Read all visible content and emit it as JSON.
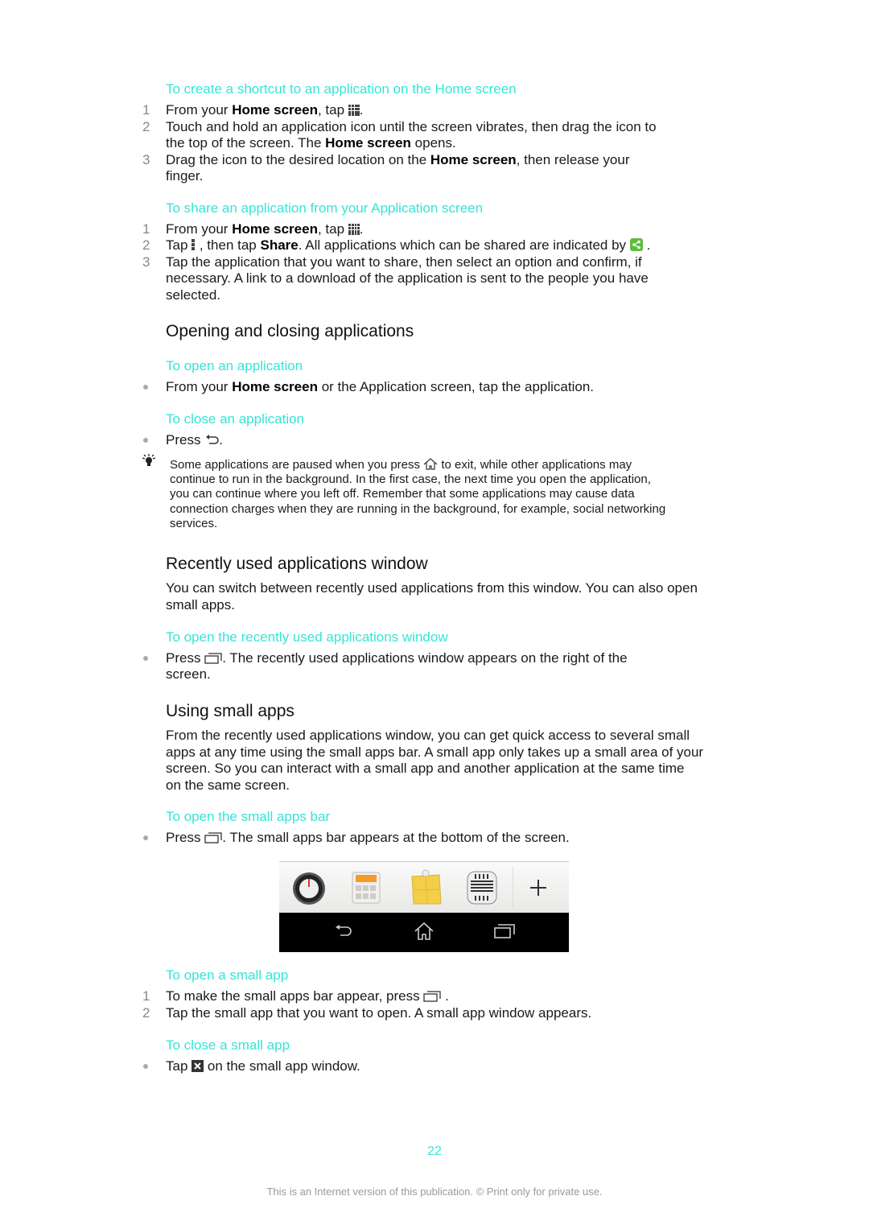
{
  "sections": {
    "shortcut": {
      "heading": "To create a shortcut to an application on the Home screen",
      "steps": [
        {
          "num": "1",
          "pre": "From your ",
          "bold": "Home screen",
          "post": ", tap ",
          "end": "."
        },
        {
          "num": "2",
          "line1": "Touch and hold an application icon until the screen vibrates, then drag the icon to",
          "line2_pre": "the top of the screen. The ",
          "bold": "Home screen",
          "line2_post": " opens."
        },
        {
          "num": "3",
          "pre": "Drag the icon to the desired location on the ",
          "bold": "Home screen",
          "post": ", then release your",
          "line2": "finger."
        }
      ]
    },
    "share": {
      "heading": "To share an application from your Application screen",
      "steps": [
        {
          "num": "1",
          "pre": "From your ",
          "bold": "Home screen",
          "post": ", tap ",
          "end": "."
        },
        {
          "num": "2",
          "pre": "Tap ",
          "mid": " , then tap ",
          "bold": "Share",
          "post": ". All applications which can be shared are indicated by ",
          "end": " ."
        },
        {
          "num": "3",
          "line1": "Tap the application that you want to share, then select an option and confirm, if",
          "line2": "necessary. A link to a download of the application is sent to the people you have",
          "line3": "selected."
        }
      ]
    },
    "opening": {
      "title": "Opening and closing applications",
      "open_heading": "To open an application",
      "open_pre": "From your ",
      "open_bold": "Home screen",
      "open_post": " or the Application screen, tap the application.",
      "close_heading": "To close an application",
      "close_text": "Press ",
      "close_end": ".",
      "tip_pre": "Some applications are paused when you press ",
      "tip_post": " to exit, while other applications may",
      "tip_lines": [
        "continue to run in the background. In the first case, the next time you open the application,",
        "you can continue where you left off. Remember that some applications may cause data",
        "connection charges when they are running in the background, for example, social networking",
        "services."
      ]
    },
    "recent": {
      "title": "Recently used applications window",
      "intro1": "You can switch between recently used applications from this window. You can also open",
      "intro2": "small apps.",
      "heading": "To open the recently used applications window",
      "text_pre": "Press ",
      "text_post": ". The recently used applications window appears on the right of the",
      "text_line2": "screen."
    },
    "small_apps": {
      "title": "Using small apps",
      "intro": [
        "From the recently used applications window, you can get quick access to several small",
        "apps at any time using the small apps bar. A small app only takes up a small area of your",
        "screen. So you can interact with a small app and another application at the same time",
        "on the same screen."
      ],
      "bar_heading": "To open the small apps bar",
      "bar_pre": "Press ",
      "bar_post": ". The small apps bar appears at the bottom of the screen.",
      "screenshot_apps": [
        "timer-app-icon",
        "calculator-app-icon",
        "notes-app-icon",
        "voice-recorder-app-icon",
        "add-icon"
      ],
      "open_heading": "To open a small app",
      "open_steps": [
        {
          "num": "1",
          "pre": "To make the small apps bar appear, press ",
          "end": " ."
        },
        {
          "num": "2",
          "text": "Tap the small app that you want to open. A small app window appears."
        }
      ],
      "close_heading": "To close a small app",
      "close_pre": "Tap ",
      "close_post": " on the small app window."
    }
  },
  "footer": {
    "page_number": "22",
    "notice": "This is an Internet version of this publication. © Print only for private use."
  },
  "colors": {
    "accent": "#33e6d6",
    "share_green": "#5cbf3a"
  }
}
